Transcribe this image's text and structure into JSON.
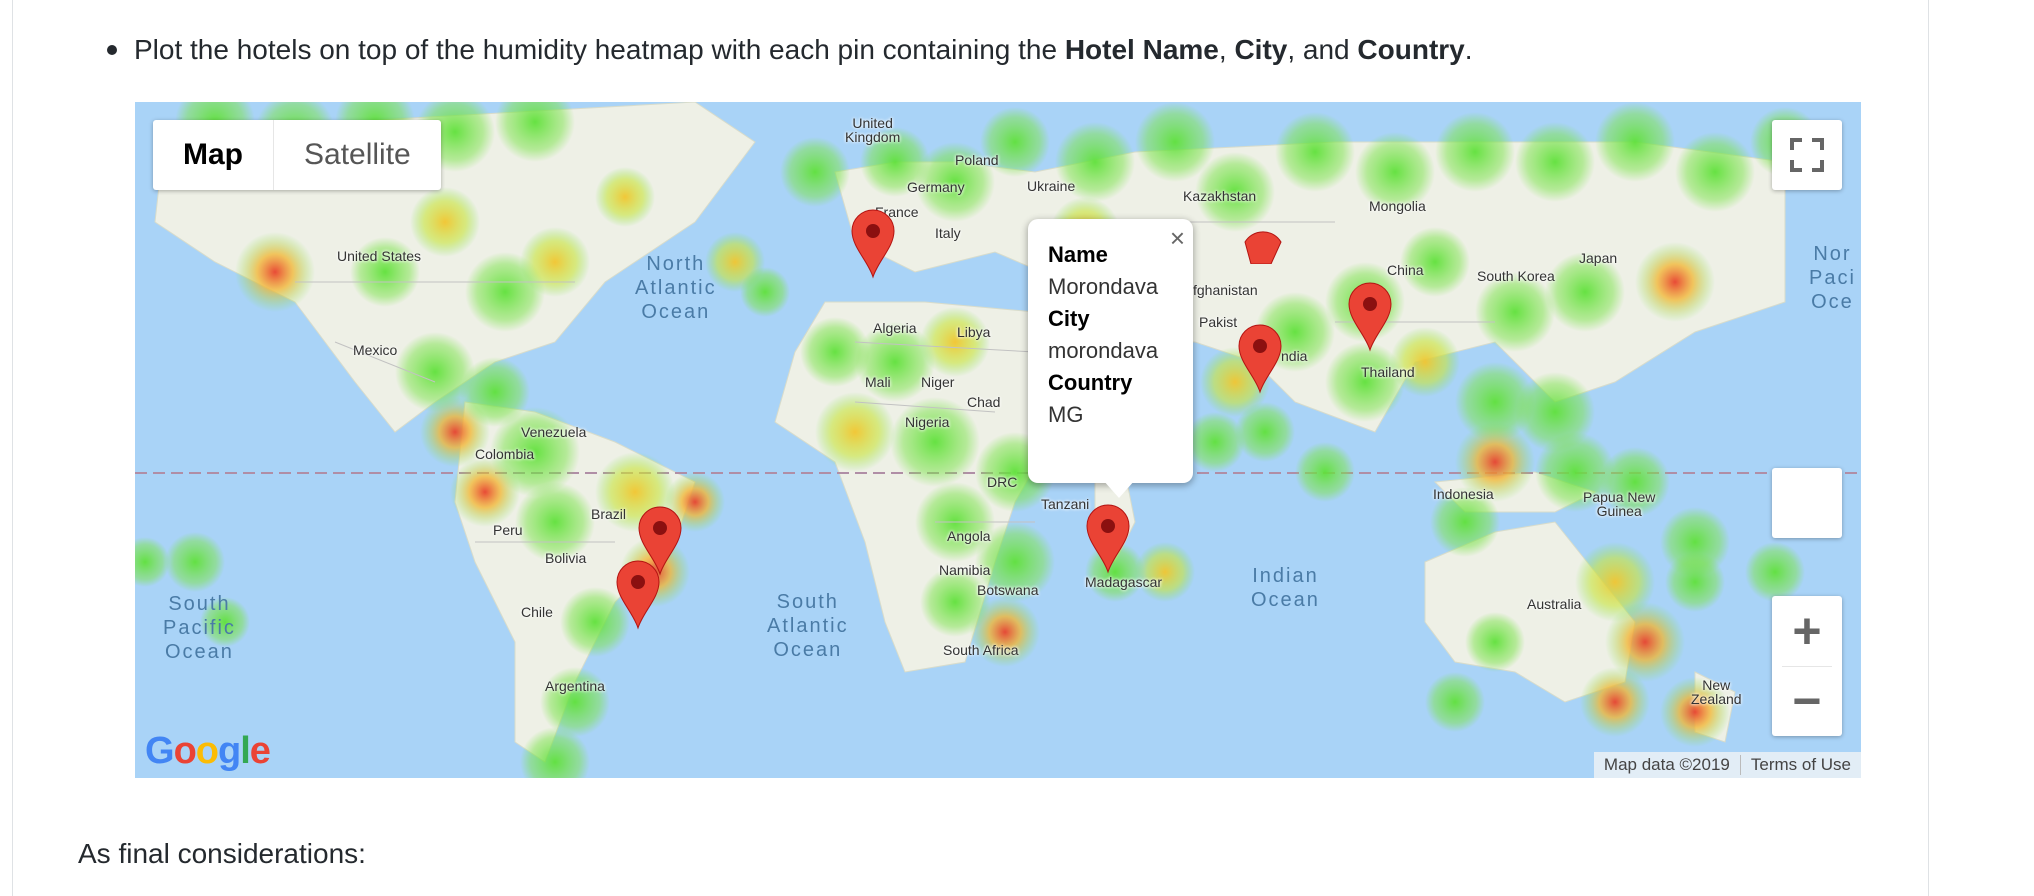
{
  "doc": {
    "bullet_prefix": "Plot the hotels on top of the humidity heatmap with each pin containing the ",
    "bold_hotel": "Hotel Name",
    "comma1": ", ",
    "bold_city": "City",
    "and": ", and ",
    "bold_country": "Country",
    "period": ".",
    "final": "As final considerations:"
  },
  "map": {
    "map_type_buttons": [
      "Map",
      "Satellite"
    ],
    "active_map_type": "Map",
    "zoom_in": "+",
    "zoom_out": "−",
    "google": "Google",
    "attribution": "Map data ©2019",
    "terms": "Terms of Use",
    "popup": {
      "name_label": "Name",
      "name_value": "Morondava",
      "city_label": "City",
      "city_value": "morondava",
      "country_label": "Country",
      "country_value": "MG",
      "close": "×"
    },
    "labels": {
      "united_kingdom": "United Kingdom",
      "poland": "Poland",
      "germany": "Germany",
      "ukraine": "Ukraine",
      "france": "France",
      "italy": "Italy",
      "kazakhstan": "Kazakhstan",
      "mongolia": "Mongolia",
      "china": "China",
      "south_korea": "South Korea",
      "japan": "Japan",
      "afghanistan": "fghanistan",
      "pakistan": "Pakist",
      "india": "ndia",
      "thailand": "Thailand",
      "united_states": "United States",
      "mexico": "Mexico",
      "venezuela": "Venezuela",
      "colombia": "Colombia",
      "peru": "Peru",
      "brazil": "Brazil",
      "bolivia": "Bolivia",
      "chile": "Chile",
      "argentina": "Argentina",
      "algeria": "Algeria",
      "libya": "Libya",
      "mali": "Mali",
      "niger": "Niger",
      "chad": "Chad",
      "nigeria": "Nigeria",
      "drc": "DRC",
      "tanzania": "Tanzani",
      "angola": "Angola",
      "namibia": "Namibia",
      "botswana": "Botswana",
      "madagascar": "Madagascar",
      "south_africa": "South Africa",
      "indonesia": "Indonesia",
      "papua": "Papua New\nGuinea",
      "australia": "Australia",
      "new_zealand": "New\nZealand",
      "north_atlantic": "North\nAtlantic\nOcean",
      "south_atlantic": "South\nAtlantic\nOcean",
      "south_pacific": "South\nPacific\nOcean",
      "indian": "Indian\nOcean",
      "north_pacific": "Nor\nPaci\nOce"
    },
    "colors": {
      "water": "#a9d3f7",
      "land": "#eef0e6",
      "pin": "#ea4335",
      "heat_low": "#5fe13a",
      "heat_mid": "#f2e52f",
      "heat_high": "#e8422d"
    }
  }
}
